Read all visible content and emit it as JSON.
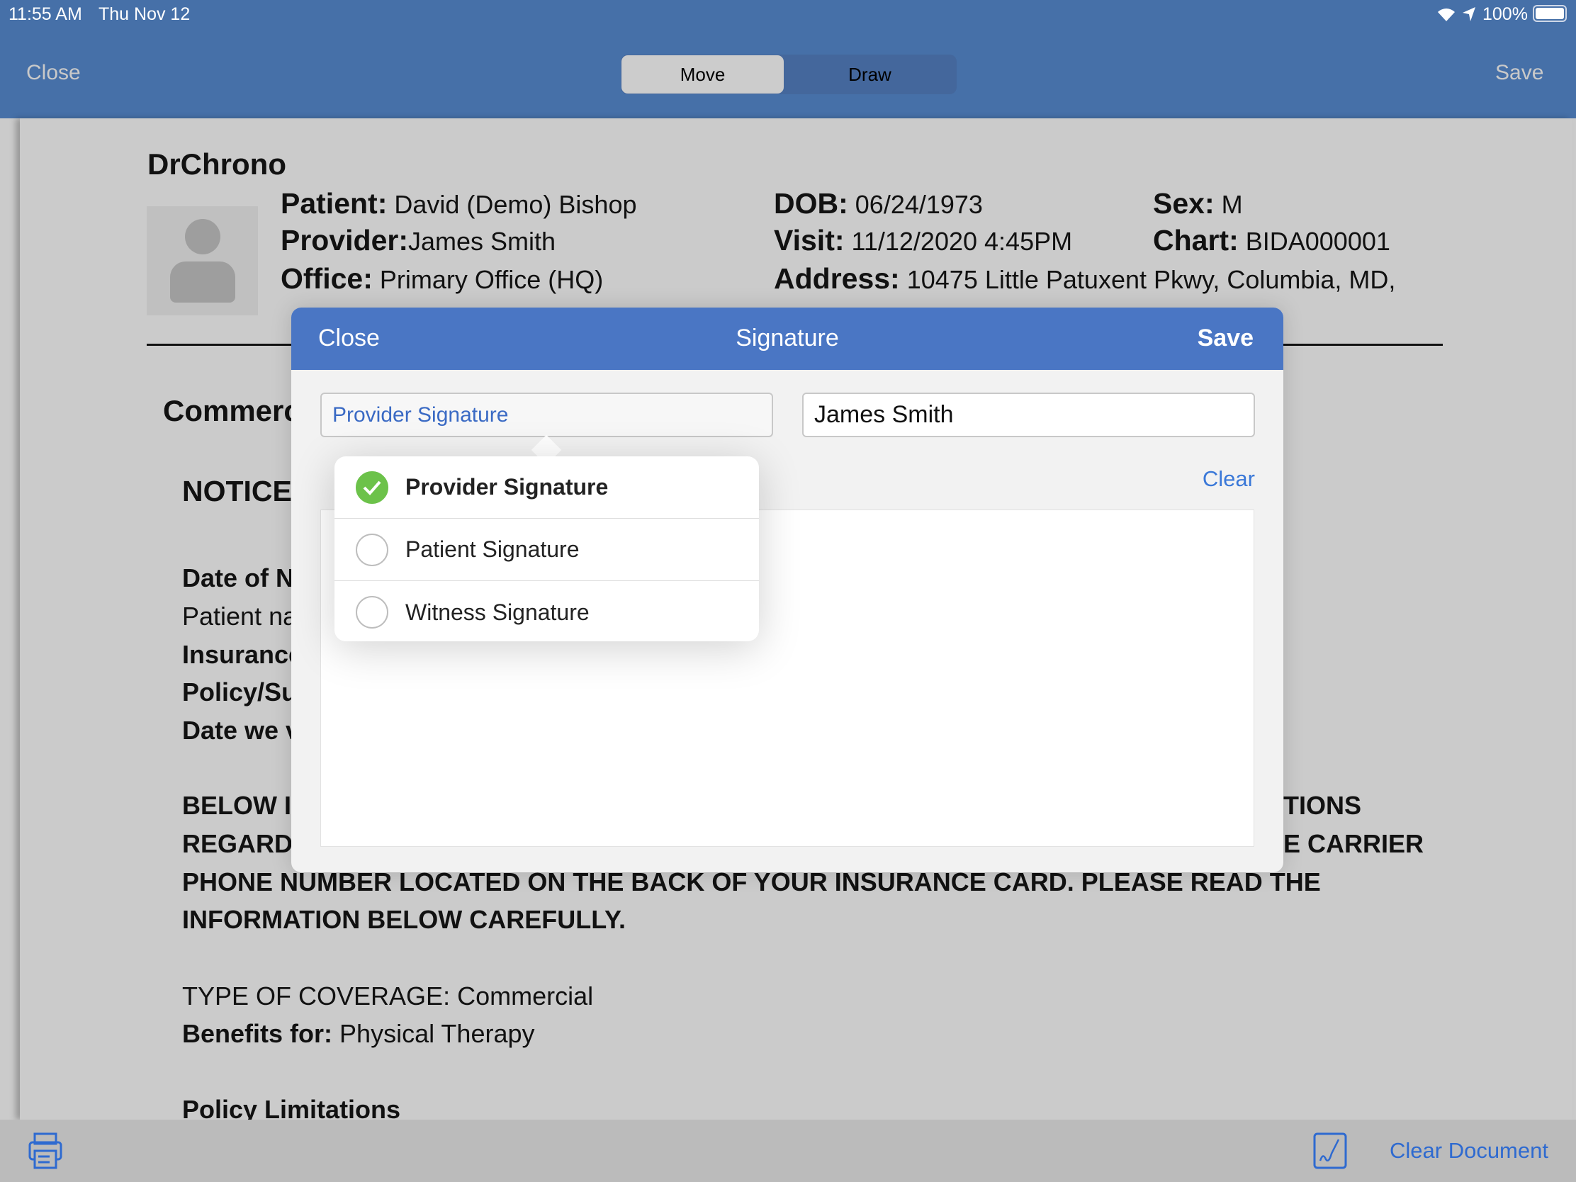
{
  "status_bar": {
    "time": "11:55 AM",
    "date": "Thu Nov 12",
    "battery": "100%",
    "icons": [
      "wifi-icon",
      "location-icon",
      "battery-icon"
    ]
  },
  "nav": {
    "close": "Close",
    "save": "Save",
    "segments": [
      "Move",
      "Draw"
    ],
    "selected_segment": "Move"
  },
  "document": {
    "brand": "DrChrono",
    "patient_label": "Patient:",
    "patient": "David (Demo) Bishop",
    "provider_label": "Provider:",
    "provider": "James Smith",
    "office_label": "Office:",
    "office": "Primary Office (HQ)",
    "dob_label": "DOB:",
    "dob": "06/24/1973",
    "visit_label": "Visit:",
    "visit": "11/12/2020 4:45PM",
    "address_label": "Address:",
    "address": "10475 Little Patuxent Pkwy, Columbia, MD,",
    "sex_label": "Sex:",
    "sex": "M",
    "chart_label": "Chart:",
    "chart": "BIDA000001",
    "fragments": {
      "commerc": "Commerc",
      "notice": "NOTICE",
      "date_of": "Date of N",
      "patient_na": "Patient na",
      "insurance": "Insurance",
      "policy_su": "Policy/Su",
      "date_we": "Date we v",
      "below_left": "BELOW I",
      "below_right": "TIONS",
      "regard_left": "REGARD",
      "regard_right": "E CARRIER"
    },
    "phone_line": "PHONE NUMBER LOCATED ON THE BACK OF YOUR INSURANCE CARD. PLEASE READ THE",
    "info_line": "INFORMATION BELOW CAREFULLY.",
    "coverage": "TYPE OF COVERAGE: Commercial",
    "benefits_label": "Benefits for:",
    "benefits": "Physical Therapy",
    "policy_limitations": "Policy Limitations"
  },
  "modal": {
    "close": "Close",
    "title": "Signature",
    "save": "Save",
    "type_value": "Provider Signature",
    "name_value": "James Smith",
    "clear": "Clear",
    "options": [
      {
        "label": "Provider Signature",
        "selected": true
      },
      {
        "label": "Patient Signature",
        "selected": false
      },
      {
        "label": "Witness Signature",
        "selected": false
      }
    ],
    "accent": "#4a76c4",
    "check_color": "#6cc24a"
  },
  "bottom": {
    "clear_document": "Clear Document",
    "icons": [
      "printer-icon",
      "signature-icon"
    ]
  }
}
